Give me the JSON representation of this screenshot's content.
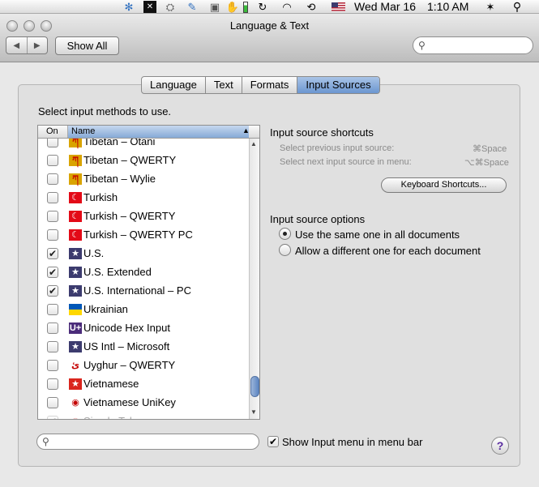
{
  "menubar": {
    "date": "Wed Mar 16",
    "time": "1:10 AM",
    "status_icons": [
      "sync-icon",
      "app-icon",
      "disk-icon",
      "edit-icon",
      "image-icon",
      "hand-icon",
      "battery-icon",
      "refresh-icon",
      "wifi-icon",
      "time-machine-icon",
      "us-flag-icon",
      "volume-icon",
      "bluetooth-icon",
      "spotlight-icon"
    ]
  },
  "window": {
    "title": "Language & Text",
    "show_all": "Show All",
    "search_placeholder": ""
  },
  "tabs": [
    {
      "label": "Language",
      "active": false
    },
    {
      "label": "Text",
      "active": false
    },
    {
      "label": "Formats",
      "active": false
    },
    {
      "label": "Input Sources",
      "active": true
    }
  ],
  "instruction": "Select input methods to use.",
  "list": {
    "col_on": "On",
    "col_name": "Name",
    "rows": [
      {
        "name": "Tibetan – Otani",
        "checked": false,
        "flag_glyph": "ཀ",
        "flag_color": "#d9a400"
      },
      {
        "name": "Tibetan – QWERTY",
        "checked": false,
        "flag_glyph": "ཀ",
        "flag_color": "#d9a400"
      },
      {
        "name": "Tibetan – Wylie",
        "checked": false,
        "flag_glyph": "ཀ",
        "flag_color": "#d9a400"
      },
      {
        "name": "Turkish",
        "checked": false,
        "flag_glyph": "☾",
        "flag_color": "#e30a17"
      },
      {
        "name": "Turkish – QWERTY",
        "checked": false,
        "flag_glyph": "☾",
        "flag_color": "#e30a17"
      },
      {
        "name": "Turkish – QWERTY PC",
        "checked": false,
        "flag_glyph": "☾",
        "flag_color": "#e30a17"
      },
      {
        "name": "U.S.",
        "checked": true,
        "flag_glyph": "★",
        "flag_color": "#3c3b6e"
      },
      {
        "name": "U.S. Extended",
        "checked": true,
        "flag_glyph": "★",
        "flag_color": "#3c3b6e"
      },
      {
        "name": "U.S. International – PC",
        "checked": true,
        "flag_glyph": "★",
        "flag_color": "#3c3b6e"
      },
      {
        "name": "Ukrainian",
        "checked": false,
        "flag_glyph": "",
        "flag_color": "#0057b7"
      },
      {
        "name": "Unicode Hex Input",
        "checked": false,
        "flag_glyph": "U+",
        "flag_color": "#4b2c7a"
      },
      {
        "name": "US Intl – Microsoft",
        "checked": false,
        "flag_glyph": "★",
        "flag_color": "#3c3b6e"
      },
      {
        "name": "Uyghur – QWERTY",
        "checked": false,
        "flag_glyph": "ئ",
        "flag_color": "#ffffff"
      },
      {
        "name": "Vietnamese",
        "checked": false,
        "flag_glyph": "★",
        "flag_color": "#da251d"
      },
      {
        "name": "Vietnamese UniKey",
        "checked": false,
        "flag_glyph": "◉",
        "flag_color": "#ffffff"
      },
      {
        "name": "Simple Telex",
        "checked": true,
        "flag_glyph": "◉",
        "flag_color": "#ffffff"
      }
    ]
  },
  "shortcuts": {
    "title": "Input source shortcuts",
    "prev_label": "Select previous input source:",
    "prev_key": "⌘Space",
    "next_label": "Select next input source in menu:",
    "next_key": "⌥⌘Space",
    "button": "Keyboard Shortcuts..."
  },
  "options": {
    "title": "Input source options",
    "radio_same": "Use the same one in all documents",
    "radio_diff": "Allow a different one for each document",
    "selected": "same"
  },
  "bottom": {
    "show_menu_label": "Show Input menu in menu bar",
    "show_menu_checked": true,
    "help": "?"
  }
}
